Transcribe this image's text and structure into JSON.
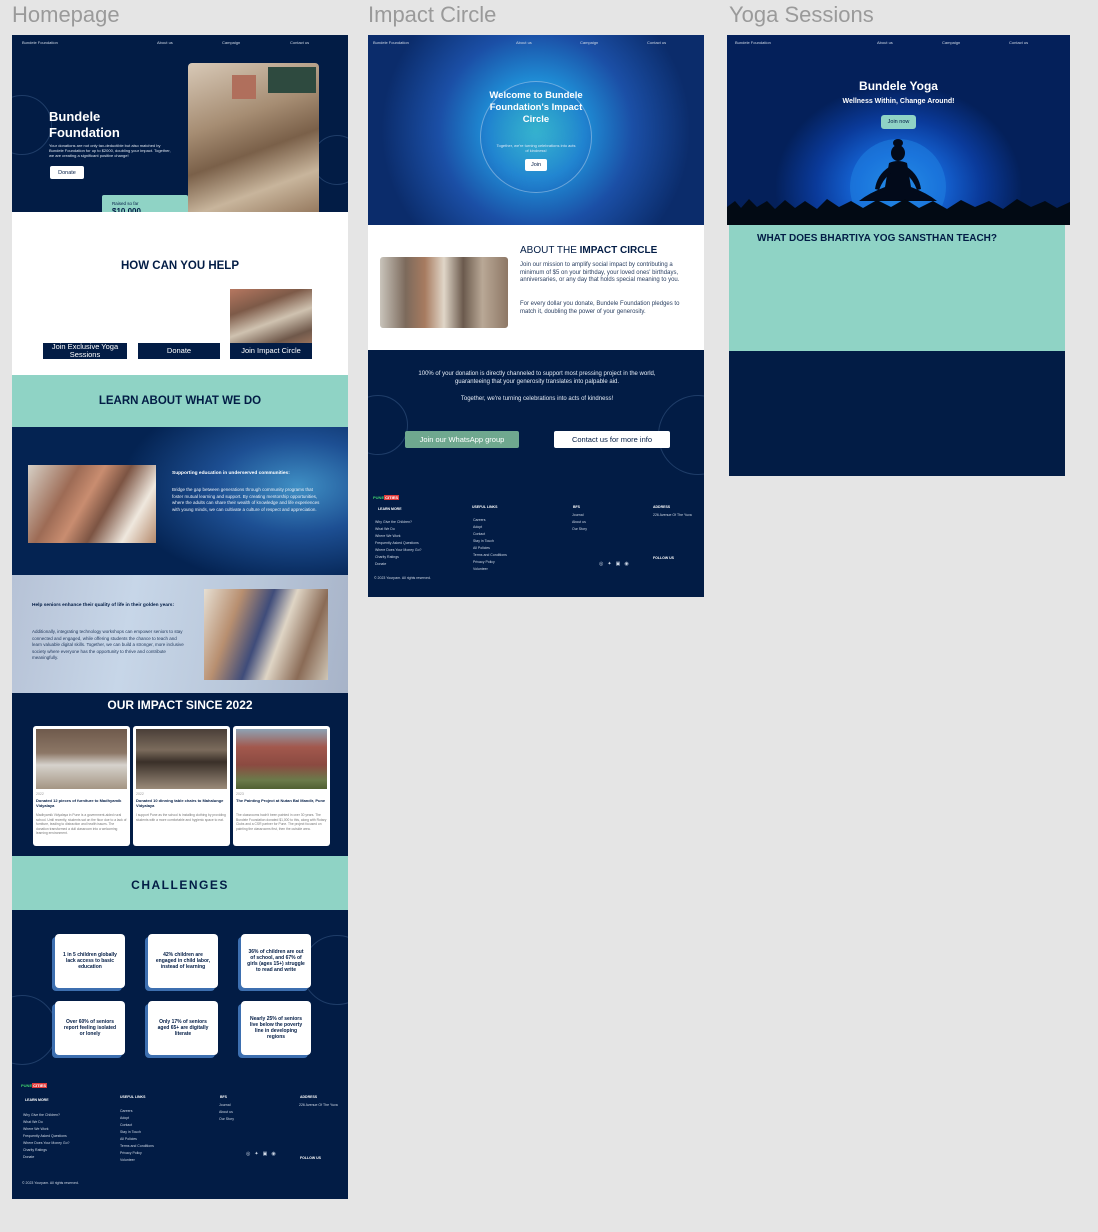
{
  "labels": {
    "home": "Homepage",
    "impact": "Impact Circle",
    "yoga": "Yoga Sessions"
  },
  "nav": {
    "brand": "Bundele Foundation",
    "about": "About us",
    "campaign": "Campaign",
    "contact": "Contact us"
  },
  "home": {
    "hero_title_1": "Bundele",
    "hero_title_2": "Foundation",
    "hero_text": "Your donations are not only tax-deductible but also matched by Bundele Foundation for up to $2000, doubling your impact. Together, we are creating a significant positive change!",
    "donate": "Donate",
    "raised_label": "Raised so far",
    "raised_value": "$10,000",
    "help_title": "HOW CAN YOU HELP",
    "help_btn_yoga": "Join Exclusive Yoga Sessions",
    "help_btn_donate": "Donate",
    "help_btn_impact": "Join Impact Circle",
    "learn_title": "LEARN ABOUT WHAT WE DO",
    "edu_title": "Supporting education in underserved communities:",
    "edu_text": "Bridge the gap between generations through community programs that foster mutual learning and support. By creating mentorship opportunities, where the adults can share their wealth of knowledge and life experiences with young minds, we can cultivate a culture of respect and appreciation.",
    "seniors_title": "Help seniors enhance their quality of life in their golden years:",
    "seniors_text": "Additionally, integrating technology workshops can empower seniors to stay connected and engaged, while offering students the chance to teach and learn valuable digital skills. Together, we can build a stronger, more inclusive society where everyone has the opportunity to thrive and contribute meaningfully.",
    "impact_title": "OUR IMPACT SINCE 2022",
    "impact_cards": [
      {
        "year": "2022",
        "title": "Donated 12 pieces of furniture to Madhyamik Vidyalaya",
        "text": "Madhyamik Vidyalaya in Pune is a government-aided rural school. Until recently, students sat on the floor due to a lack of furniture, leading to distraction and health issues. The donation transformed a dull classroom into a welcoming learning environment."
      },
      {
        "year": "2022",
        "title": "Donated 10 dinning table chairs to Mahalunge Vidyalaya",
        "text": "I support Pune as the school is installing clothing by providing students with a more comfortable and hygienic space to eat."
      },
      {
        "year": "2023",
        "title": "The Painting Project at Nutan Bal Mandir, Pune",
        "text": "The classrooms hadn't been painted in over 30 years. The Bundele Foundation donated $1,000 to this, along with Rotary Clubs and a CSR partner for Pune. The project focused on painting the classrooms first, then the outside area."
      }
    ],
    "challenges_title": "CHALLENGES",
    "challenges": [
      "1 in 5 children globally lack access to basic education",
      "42% children are engaged in child labor, instead of learning",
      "36% of children are out of school, and 67% of girls (ages 15+) struggle to read and write",
      "Over 60% of seniors report feeling isolated or lonely",
      "Only 17% of seniors aged 65+ are digitally literate",
      "Nearly 25% of seniors live below the poverty line in developing regions"
    ]
  },
  "impact": {
    "hero_title": "Welcome to Bundele Foundation's Impact Circle",
    "hero_sub": "Together, we're turning celebrations into acts of kindness!",
    "join": "Join",
    "about_prefix": "ABOUT THE ",
    "about_bold": "IMPACT CIRCLE",
    "about_p1": "Join our mission to amplify social impact by contributing a minimum of $5 on your birthday, your loved ones' birthdays, anniversaries, or any day that holds special meaning to you.",
    "about_p2": "For every dollar you donate, Bundele Foundation pledges to match it, doubling the power of your generosity.",
    "mid_p1": "100% of your donation is directly channeled to support most pressing project in the world, guaranteeing that your generosity translates into palpable aid.",
    "mid_p2": "Together, we're turning celebrations into acts of kindness!",
    "whatsapp": "Join our WhatsApp group",
    "contact_more": "Contact us for more info"
  },
  "yoga": {
    "title": "Bundele Yoga",
    "subtitle": "Wellness Within, Change Around!",
    "join_now": "Join now",
    "teach_title": "WHAT DOES BHARTIYA YOG SANSTHAN TEACH?"
  },
  "footer": {
    "logo_green": "PUNE",
    "logo_red": "CITIES",
    "learn_more": "LEARN MORE",
    "learn_items": [
      "Why Give the Children?",
      "What We Do",
      "Where We Work",
      "Frequently Asked Questions",
      "Where Does Your Money Go?",
      "Charity Ratings",
      "Donate"
    ],
    "useful_links": "USEFUL LINKS",
    "useful_items": [
      "Careers",
      "Adopt",
      "Contact",
      "Stay in Touch",
      "All Policies",
      "Terms and Conditions",
      "Privacy Policy",
      "Volunteer"
    ],
    "bfs": "BFS",
    "bfs_items": [
      "Journal",
      "About us",
      "Our Story"
    ],
    "address_h": "ADDRESS",
    "address": "226 Avenue Of The Yuva",
    "follow": "FOLLOW US",
    "copyright": "© 2023 Yourpam. All rights reserved."
  },
  "colors": {
    "navy": "#021c45",
    "mint": "#8fd3c5",
    "accent_blue": "#1e6fd9",
    "whatsapp": "#6fa88f"
  }
}
